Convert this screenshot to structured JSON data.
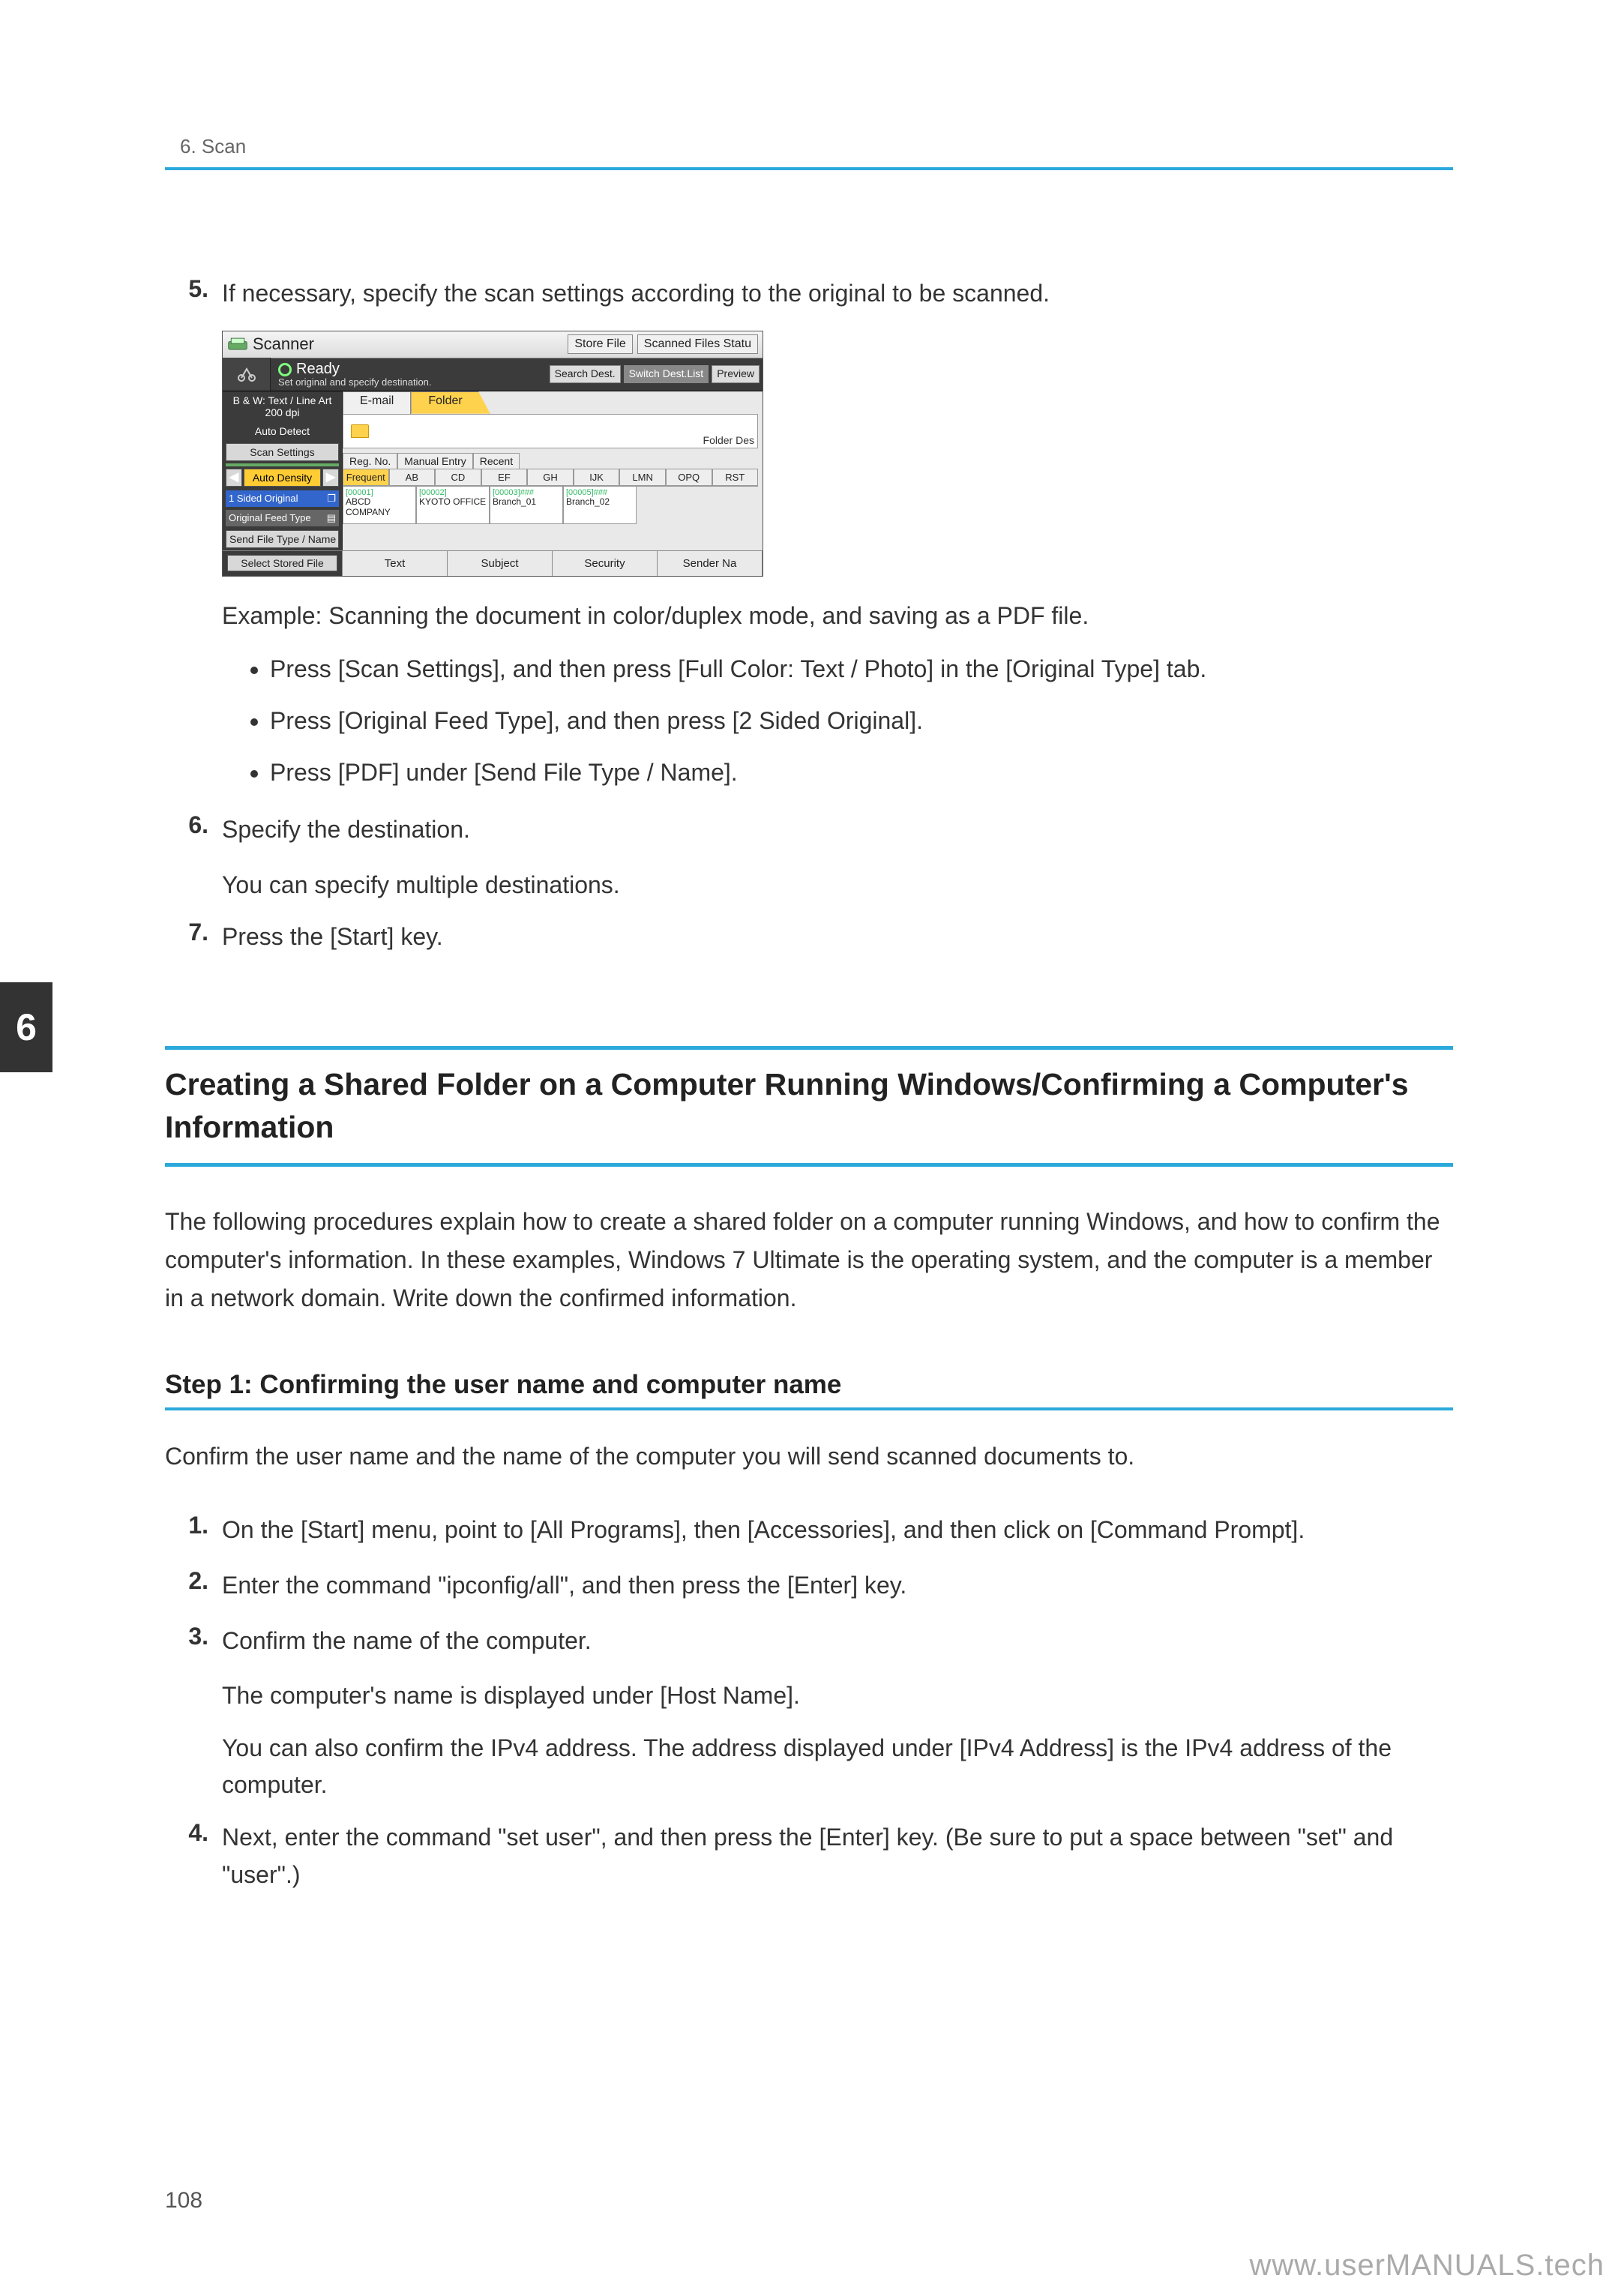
{
  "header": {
    "chapter_label": "6. Scan",
    "chapter_tab": "6"
  },
  "page_number": "108",
  "watermark": "www.userMANUALS.tech",
  "steps_a": {
    "s5": {
      "num": "5.",
      "text": "If necessary, specify the scan settings according to the original to be scanned.",
      "example": "Example: Scanning the document in color/duplex mode, and saving as a PDF file.",
      "b1": "Press [Scan Settings], and then press [Full Color: Text / Photo] in the [Original Type] tab.",
      "b2": "Press [Original Feed Type], and then press [2 Sided Original].",
      "b3": "Press [PDF] under [Send File Type / Name]."
    },
    "s6": {
      "num": "6.",
      "text": "Specify the destination.",
      "sub": "You can specify multiple destinations."
    },
    "s7": {
      "num": "7.",
      "text": "Press the [Start] key."
    }
  },
  "h2": "Creating a Shared Folder on a Computer Running Windows/Confirming a Computer's Information",
  "para1": "The following procedures explain how to create a shared folder on a computer running Windows, and how to confirm the computer's information. In these examples, Windows 7 Ultimate is the operating system, and the computer is a member in a network domain. Write down the confirmed information.",
  "h3": "Step 1: Confirming the user name and computer name",
  "para2": "Confirm the user name and the name of the computer you will send scanned documents to.",
  "steps_b": {
    "s1": {
      "num": "1.",
      "text": "On the [Start] menu, point to [All Programs], then [Accessories], and then click on [Command Prompt]."
    },
    "s2": {
      "num": "2.",
      "text": "Enter the command \"ipconfig/all\", and then press the [Enter] key."
    },
    "s3": {
      "num": "3.",
      "text": "Confirm the name of the computer.",
      "sub1": "The computer's name is displayed under [Host Name].",
      "sub2": "You can also confirm the IPv4 address. The address displayed under [IPv4 Address] is the IPv4 address of the computer."
    },
    "s4": {
      "num": "4.",
      "text": "Next, enter the command \"set user\", and then press the [Enter] key. (Be sure to put a space between \"set\" and \"user\".)"
    }
  },
  "scanner": {
    "title": "Scanner",
    "top_btn1": "Store File",
    "top_btn2": "Scanned Files Statu",
    "ready": "Ready",
    "ready_sub": "Set original and specify destination.",
    "status_search": "Search Dest.",
    "status_switch": "Switch Dest.List",
    "status_preview": "Preview",
    "left": {
      "l1a": "B & W: Text / Line Art",
      "l1b": "200 dpi",
      "l2": "Auto Detect",
      "scan_settings": "Scan Settings",
      "auto_density": "Auto Density",
      "sided": "1 Sided Original",
      "feed": "Original Feed Type",
      "filetype": "Send File Type / Name",
      "stored": "Select Stored File"
    },
    "tabs": {
      "email": "E-mail",
      "folder": "Folder"
    },
    "folder_des": "Folder Des",
    "subtabs": {
      "reg": "Reg. No.",
      "manual": "Manual Entry",
      "recent": "Recent"
    },
    "alpha": [
      "Frequent",
      "AB",
      "CD",
      "EF",
      "GH",
      "IJK",
      "LMN",
      "OPQ",
      "RST"
    ],
    "cards": [
      {
        "id": "[00001]",
        "name": "ABCD COMPANY"
      },
      {
        "id": "[00002]",
        "name": "KYOTO OFFICE"
      },
      {
        "id": "[00003]###",
        "name": "Branch_01"
      },
      {
        "id": "[00005]###",
        "name": "Branch_02"
      }
    ],
    "bottom": {
      "text": "Text",
      "subject": "Subject",
      "security": "Security",
      "sender": "Sender Na"
    }
  }
}
